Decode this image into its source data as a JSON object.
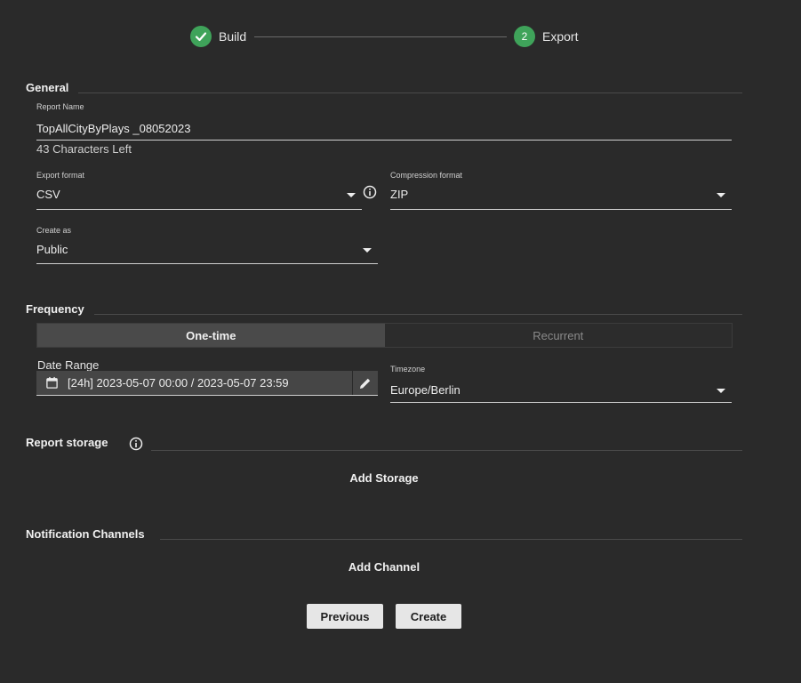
{
  "stepper": {
    "step1_label": "Build",
    "step2_number": "2",
    "step2_label": "Export"
  },
  "general": {
    "title": "General",
    "report_name_label": "Report Name",
    "report_name_value": "TopAllCityByPlays _08052023",
    "chars_left": "43 Characters Left",
    "export_format_label": "Export format",
    "export_format_value": "CSV",
    "compression_label": "Compression format",
    "compression_value": "ZIP",
    "create_as_label": "Create as",
    "create_as_value": "Public"
  },
  "frequency": {
    "title": "Frequency",
    "one_time": "One-time",
    "recurrent": "Recurrent",
    "date_range_label": "Date Range",
    "date_range_value": "[24h] 2023-05-07 00:00 / 2023-05-07 23:59",
    "timezone_label": "Timezone",
    "timezone_value": "Europe/Berlin"
  },
  "report_storage": {
    "title": "Report storage",
    "add_label": "Add Storage"
  },
  "notifications": {
    "title": "Notification Channels",
    "add_label": "Add Channel"
  },
  "footer": {
    "previous_label": "Previous",
    "create_label": "Create"
  },
  "colors": {
    "background": "#2a2a2a",
    "step_accent": "#3fa35a",
    "button_bg": "#e6e6e6"
  },
  "icons": [
    "check-icon",
    "info-icon",
    "calendar-icon",
    "pencil-icon",
    "chevron-down-icon"
  ]
}
